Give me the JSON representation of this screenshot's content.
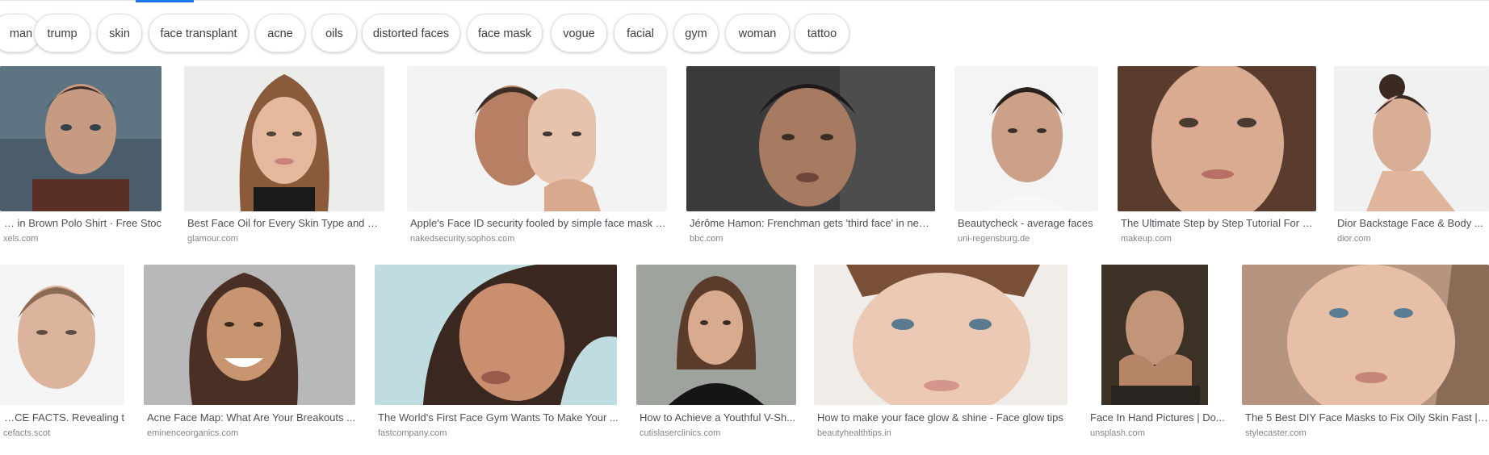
{
  "related_searches": [
    "man",
    "trump",
    "skin",
    "face transplant",
    "acne",
    "oils",
    "distorted faces",
    "face mask",
    "vogue",
    "facial",
    "gym",
    "woman",
    "tattoo"
  ],
  "row1": [
    {
      "caption": "an in Brown Polo Shirt · Free Stoc...",
      "source": "xels.com"
    },
    {
      "caption": "Best Face Oil for Every Skin Type and Ho...",
      "source": "glamour.com"
    },
    {
      "caption": "Apple's Face ID security fooled by simple face mask –...",
      "source": "nakedsecurity.sophos.com"
    },
    {
      "caption": "Jérôme Hamon: Frenchman gets 'third face' in new t...",
      "source": "bbc.com"
    },
    {
      "caption": "Beautycheck - average faces",
      "source": "uni-regensburg.de"
    },
    {
      "caption": "The Ultimate Step by Step Tutorial For P...",
      "source": "makeup.com"
    },
    {
      "caption": "Dior Backstage Face & Body ...",
      "source": "dior.com"
    }
  ],
  "row2": [
    {
      "caption": "ACE FACTS. Revealing t...",
      "source": "cefacts.scot"
    },
    {
      "caption": "Acne Face Map: What Are Your Breakouts ...",
      "source": "eminenceorganics.com"
    },
    {
      "caption": "The World's First Face Gym Wants To Make Your ...",
      "source": "fastcompany.com"
    },
    {
      "caption": "How to Achieve a Youthful V-Sh...",
      "source": "cutislaserclinics.com"
    },
    {
      "caption": "How to make your face glow & shine - Face glow tips",
      "source": "beautyhealthtips.in"
    },
    {
      "caption": "Face In Hand Pictures | Do...",
      "source": "unsplash.com"
    },
    {
      "caption": "The 5 Best DIY Face Masks to Fix Oily Skin Fast | ...",
      "source": "stylecaster.com"
    }
  ],
  "colors": {
    "chip_border": "#dfe1e5",
    "caption": "#4d5156",
    "source": "#80868b",
    "accent": "#1a73e8"
  },
  "icons": [
    "face-photo-thumbnail"
  ]
}
